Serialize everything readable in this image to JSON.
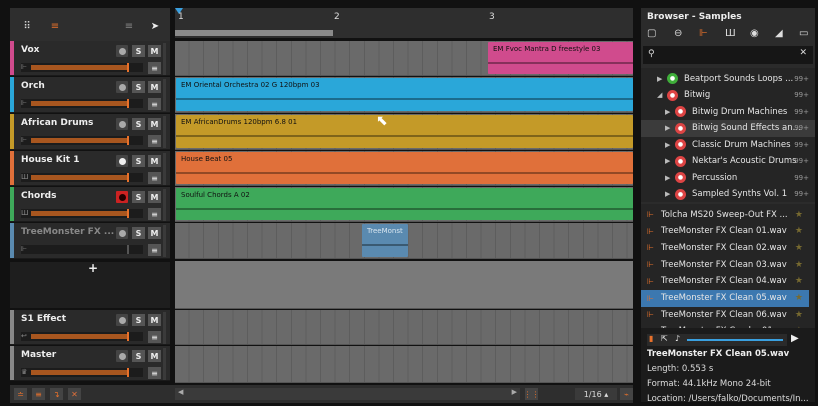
{
  "header": {
    "grid_icon": "grid-icon",
    "list_icon": "list-icon",
    "pointer_icon": "pointer-arrow-icon"
  },
  "ruler": {
    "marks": [
      "1",
      "2",
      "3"
    ]
  },
  "tracks": [
    {
      "name": "Vox",
      "color": "#d04b8d",
      "icon": "audio-icon",
      "solo": "S",
      "mute": "M"
    },
    {
      "name": "Orch",
      "color": "#2aa7d9",
      "icon": "audio-icon",
      "solo": "S",
      "mute": "M"
    },
    {
      "name": "African Drums",
      "color": "#c49a28",
      "icon": "audio-icon",
      "solo": "S",
      "mute": "M"
    },
    {
      "name": "House Kit 1",
      "color": "#e0703a",
      "icon": "instrument-icon",
      "solo": "S",
      "mute": "M"
    },
    {
      "name": "Chords",
      "color": "#3ea95a",
      "icon": "instrument-icon",
      "solo": "S",
      "mute": "M"
    },
    {
      "name": "TreeMonster FX ...",
      "color": "#5a8ab0",
      "icon": "audio-icon",
      "solo": "S",
      "mute": "M"
    },
    {
      "name": "S1 Effect",
      "color": "#888888",
      "icon": "return-icon",
      "solo": "S",
      "mute": "M"
    },
    {
      "name": "Master",
      "color": "#888888",
      "icon": "master-icon",
      "solo": "S",
      "mute": "M"
    }
  ],
  "add_track": "+",
  "clips": [
    {
      "name": "EM Fvoc Mantra D freestyle 03",
      "color": "#d04b8d"
    },
    {
      "name": "EM Oriental Orchestra 02 G 120bpm 03",
      "color": "#2aa7d9"
    },
    {
      "name": "EM AfricanDrums 120bpm 6.8 01",
      "color": "#c49a28"
    },
    {
      "name": "House Beat 05",
      "color": "#e0703a"
    },
    {
      "name": "Soulful Chords A 02",
      "color": "#3ea95a"
    },
    {
      "name": "TreeMonst",
      "color": "#5a8ab0"
    }
  ],
  "bottom": {
    "zoom": "1/16 ▴"
  },
  "browser": {
    "title": "Browser - Samples",
    "search_placeholder": "",
    "close": "✕",
    "tree": [
      {
        "label": "Beatport Sounds Loops ...",
        "count": "99+",
        "tri": "▶",
        "ic": "#3fae3a"
      },
      {
        "label": "Bitwig",
        "count": "99+",
        "tri": "◢",
        "ic": "#d44"
      },
      {
        "label": "Bitwig Drum Machines",
        "count": "99+",
        "tri": "▶",
        "ic": "#d44"
      },
      {
        "label": "Bitwig Sound Effects an...",
        "count": "99+",
        "tri": "▶",
        "ic": "#d44"
      },
      {
        "label": "Classic Drum Machines",
        "count": "99+",
        "tri": "▶",
        "ic": "#d44"
      },
      {
        "label": "Nektar's Acoustic Drums",
        "count": "99+",
        "tri": "▶",
        "ic": "#d44"
      },
      {
        "label": "Percussion",
        "count": "99+",
        "tri": "▶",
        "ic": "#d44"
      },
      {
        "label": "Sampled Synths Vol. 1",
        "count": "99+",
        "tri": "▶",
        "ic": "#d44"
      }
    ],
    "files": [
      "Tolcha MS20 Sweep-Out FX ...",
      "TreeMonster FX Clean 01.wav",
      "TreeMonster FX Clean 02.wav",
      "TreeMonster FX Clean 03.wav",
      "TreeMonster FX Clean 04.wav",
      "TreeMonster FX Clean 05.wav",
      "TreeMonster FX Clean 06.wav",
      "TreeMonster FX Combo 01..."
    ],
    "selected_file": "TreeMonster FX Clean 05.wav",
    "info": {
      "title": "TreeMonster FX Clean 05.wav",
      "length": "Length: 0.553 s",
      "format": "Format: 44.1kHz Mono 24-bit",
      "location": "Location: /Users/falko/Documents/In..."
    }
  }
}
